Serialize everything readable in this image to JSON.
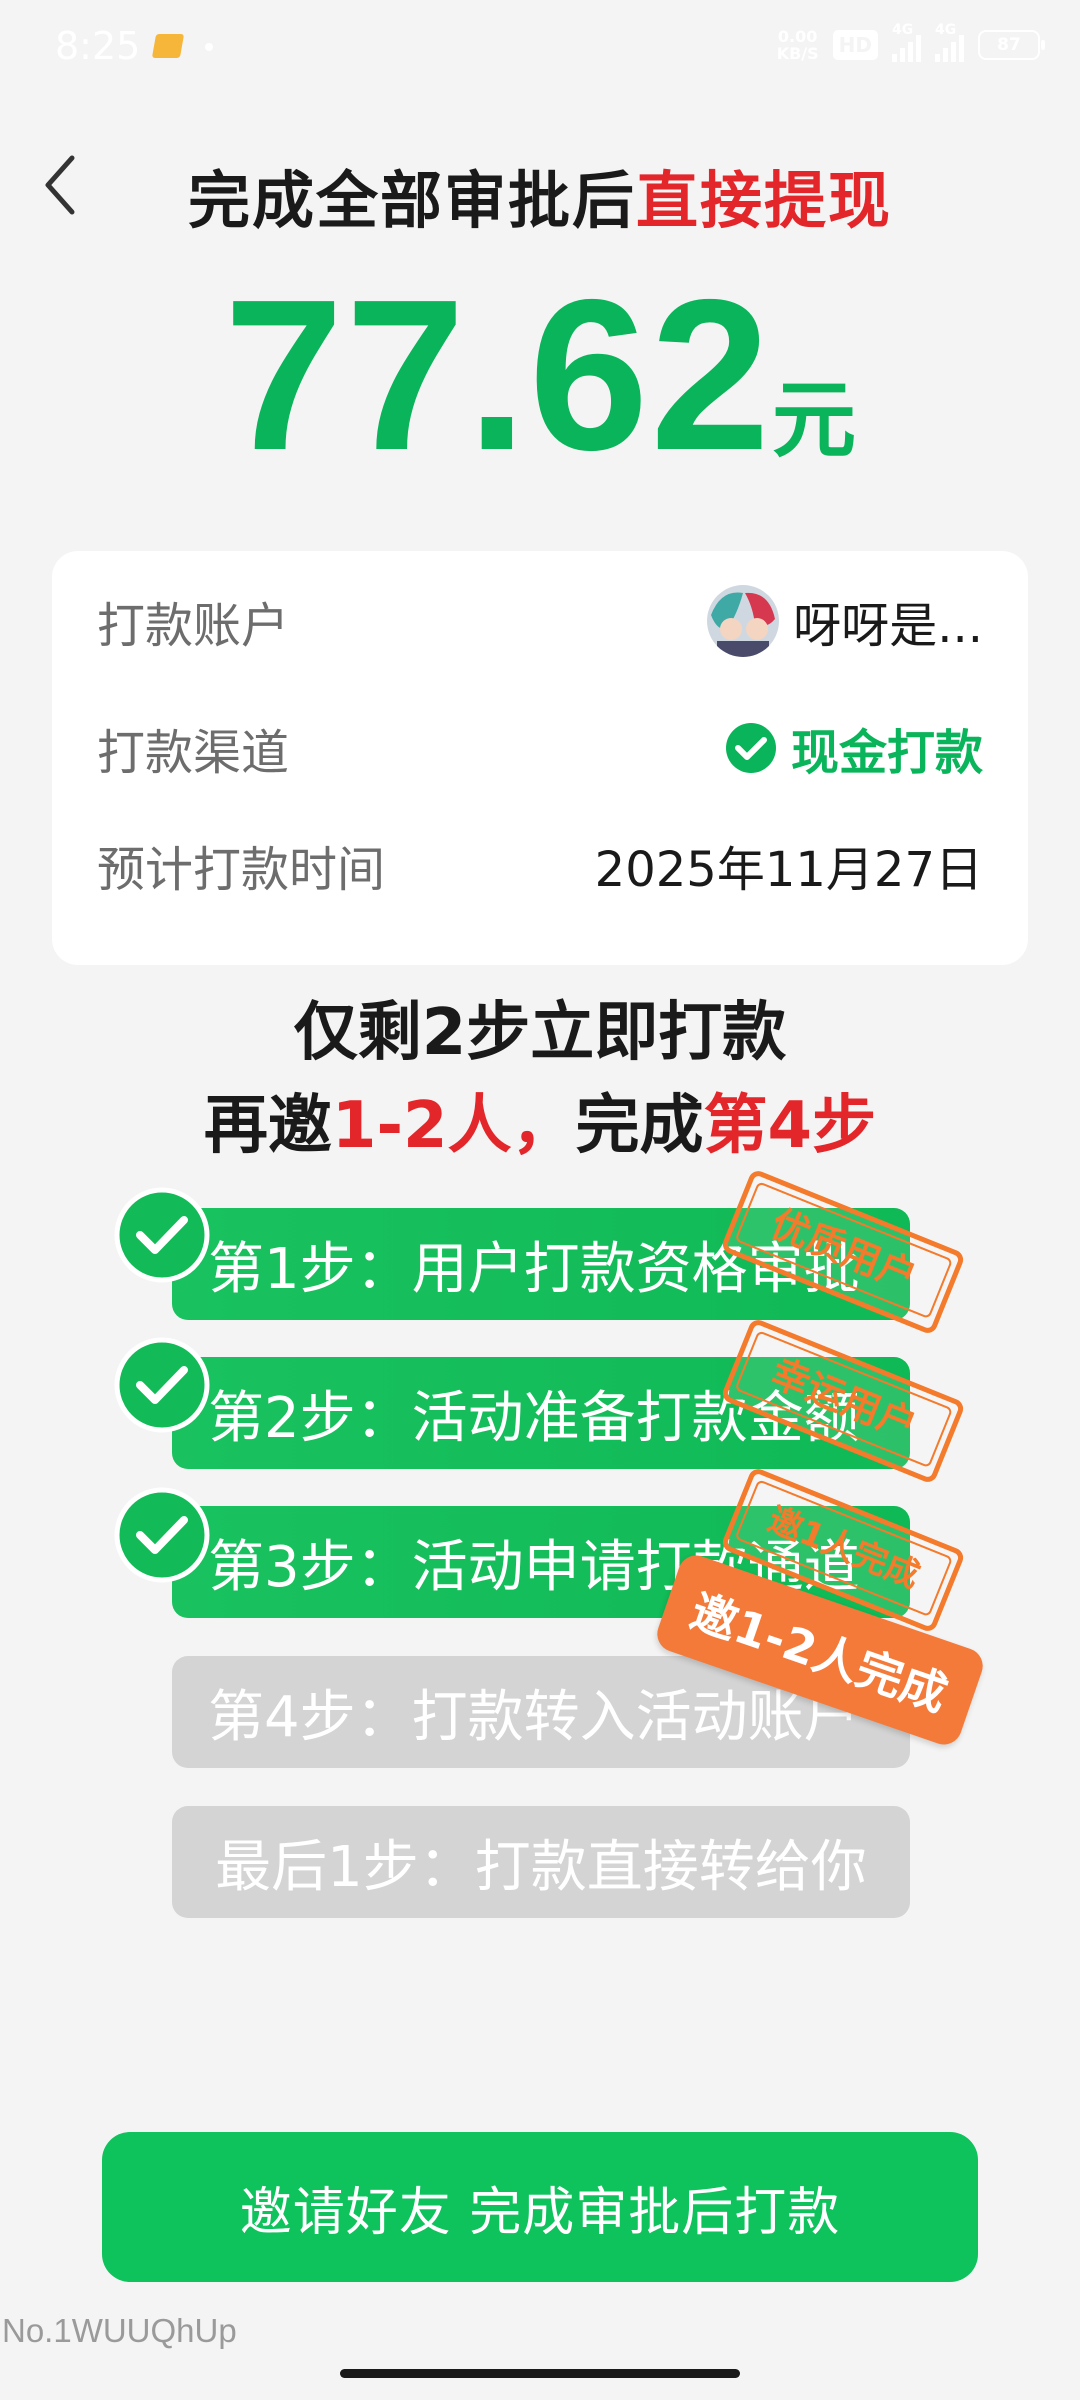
{
  "status_bar": {
    "time": "8:25",
    "net_speed_top": "0.00",
    "net_speed_unit": "KB/S",
    "hd": "HD",
    "signal1_label": "4G",
    "signal2_label": "4G",
    "battery": "87"
  },
  "header": {
    "title_part1": "完成全部审批后",
    "title_part2": "直接提现"
  },
  "amount": {
    "value": "77.62",
    "unit": "元"
  },
  "info": {
    "account_label": "打款账户",
    "account_value": "呀呀是...",
    "channel_label": "打款渠道",
    "channel_value": "现金打款",
    "time_label": "预计打款时间",
    "time_value": "2025年11月27日"
  },
  "progress": {
    "title": "仅剩2步立即打款",
    "sub_part1": "再邀",
    "sub_part2": "1-2人，",
    "sub_part3": "完成",
    "sub_part4": "第4步"
  },
  "steps": [
    {
      "label": "第1步：用户打款资格审批",
      "status": "done",
      "stamp": "优质用户"
    },
    {
      "label": "第2步：活动准备打款金额",
      "status": "done",
      "stamp": "幸运用户"
    },
    {
      "label": "第3步：活动申请打款通道",
      "status": "done",
      "stamp": "邀1人完成"
    },
    {
      "label": "第4步：打款转入活动账户",
      "status": "pending",
      "tag": "邀1-2人完成"
    },
    {
      "label": "最后1步：打款直接转给你",
      "status": "pending"
    }
  ],
  "invite_button": "邀请好友 完成审批后打款",
  "footer_code": "No.1WUUQhUp",
  "colors": {
    "green": "#0ab45a",
    "red": "#e3262a",
    "orange": "#f47a2c",
    "gray_step": "#d4d4d4"
  }
}
